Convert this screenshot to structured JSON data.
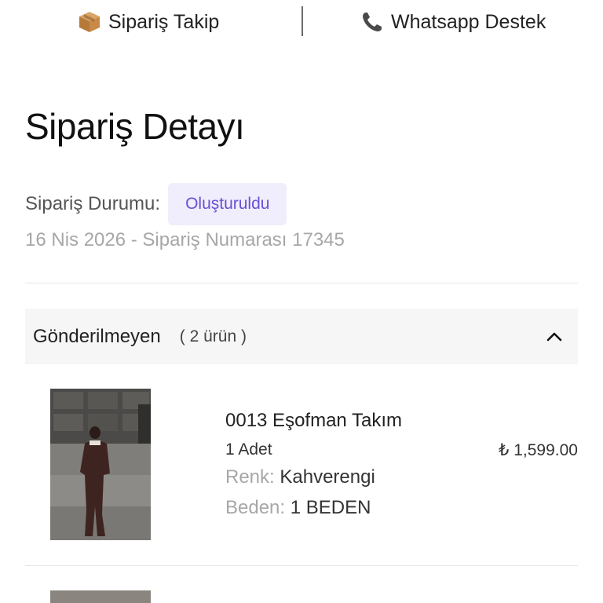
{
  "topbar": {
    "track_label": "Sipariş Takip",
    "track_icon": "package-icon",
    "support_label": "Whatsapp Destek",
    "support_icon": "phone-icon"
  },
  "page_title": "Sipariş Detayı",
  "order": {
    "status_label": "Sipariş Durumu:",
    "status_value": "Oluşturuldu",
    "meta": "16 Nis 2026 - Sipariş Numarası 17345"
  },
  "group": {
    "title": "Gönderilmeyen",
    "count": "( 2 ürün )",
    "chevron_icon": "chevron-up-icon"
  },
  "items": [
    {
      "name": "0013 Eşofman Takım",
      "quantity": "1 Adet",
      "price": "₺ 1,599.00",
      "color_key": "Renk:",
      "color_value": "Kahverengi",
      "size_key": "Beden:",
      "size_value": "1 BEDEN"
    }
  ],
  "colors": {
    "accent": "#6a4fd6",
    "badge_bg": "#f0edfc",
    "muted": "#a7a7a7"
  }
}
